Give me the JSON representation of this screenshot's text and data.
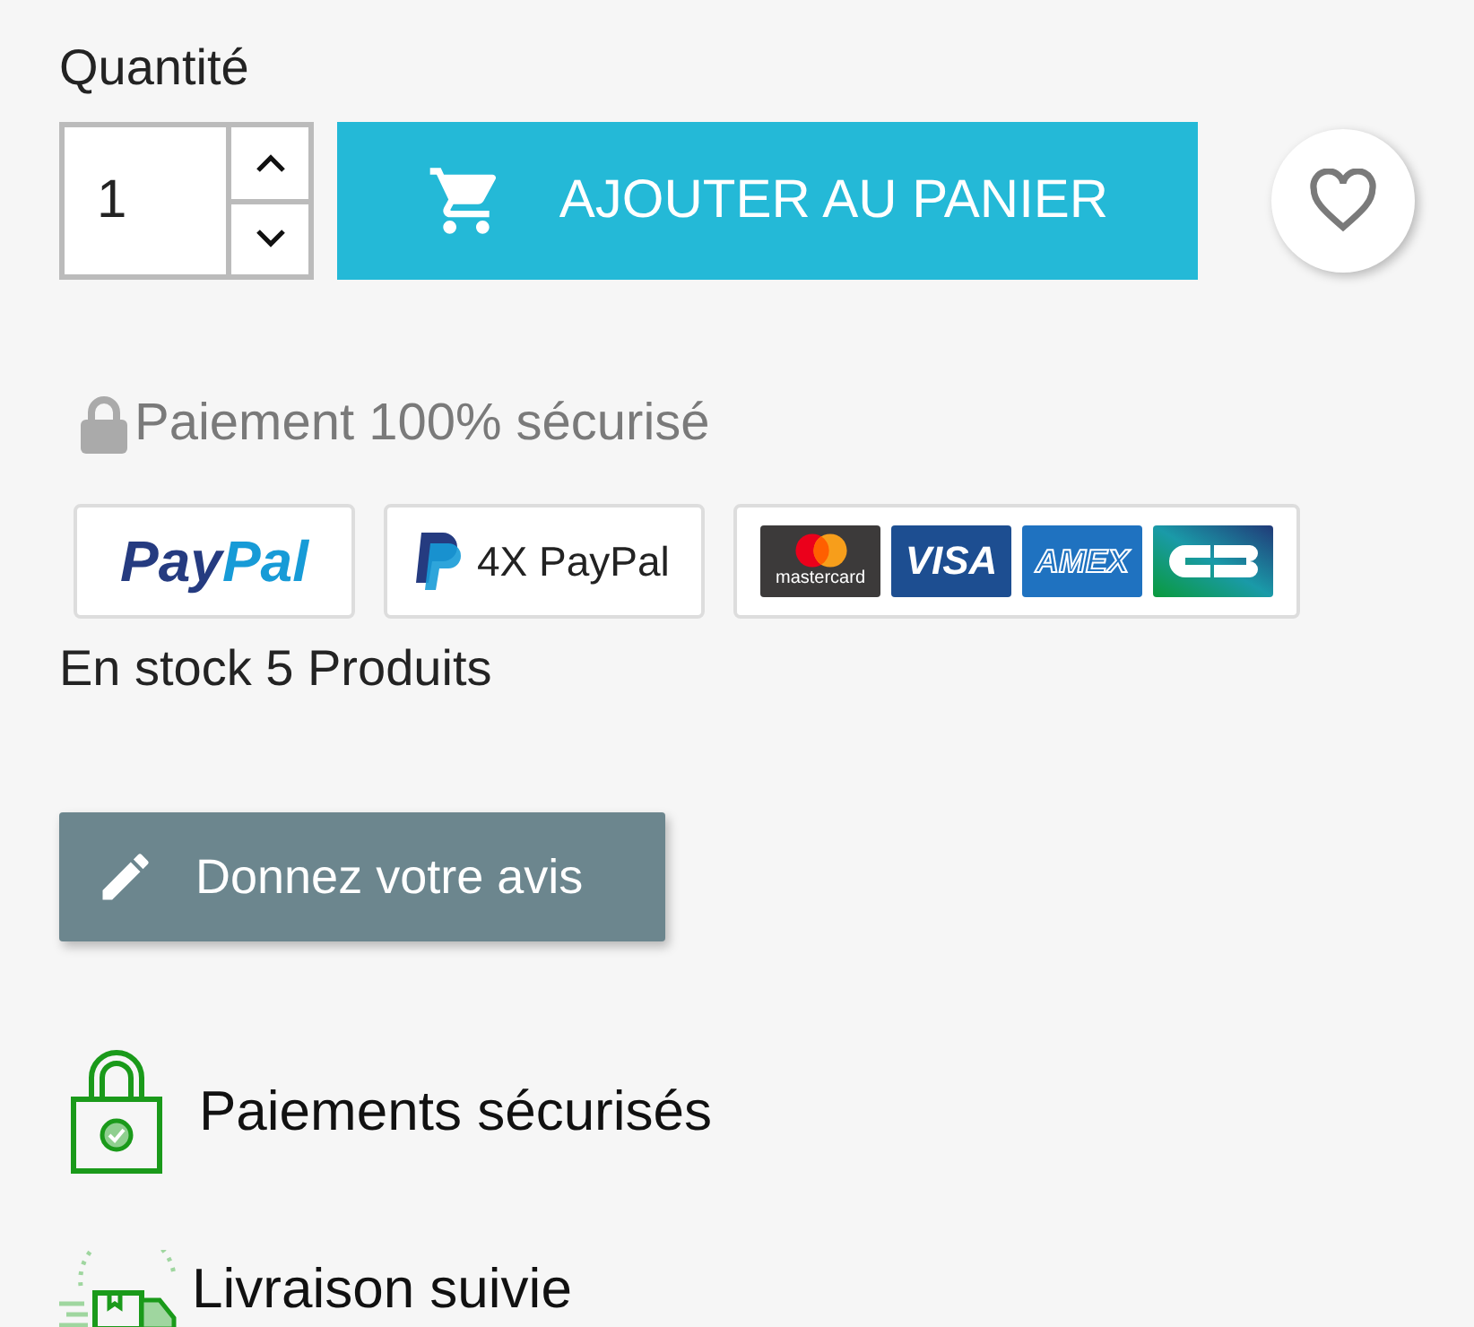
{
  "quantity": {
    "label": "Quantité",
    "value": "1"
  },
  "add_to_cart": {
    "label": "AJOUTER AU PANIER"
  },
  "secure_payment": "Paiement 100% sécurisé",
  "payment_badges": [
    {
      "kind": "paypal",
      "parts": [
        "Pay",
        "Pal"
      ]
    },
    {
      "kind": "paypal4x",
      "text": "4X PayPal"
    },
    {
      "kind": "cards",
      "cards": [
        {
          "kind": "mastercard",
          "text": "mastercard"
        },
        {
          "kind": "visa",
          "text": "VISA"
        },
        {
          "kind": "amex",
          "text": "AMEX"
        },
        {
          "kind": "cb"
        }
      ]
    }
  ],
  "stock": "En stock 5 Produits",
  "review_button": "Donnez votre avis",
  "reassurance": [
    {
      "kind": "secure",
      "text": "Paiements sécurisés"
    },
    {
      "kind": "delivery",
      "text": "Livraison suivie"
    }
  ]
}
